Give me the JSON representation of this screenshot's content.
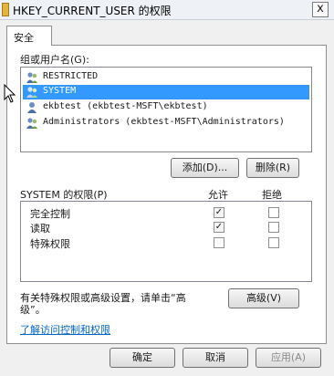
{
  "window": {
    "title": "HKEY_CURRENT_USER 的权限",
    "close_label": "x"
  },
  "tabs": [
    {
      "label": "安全"
    }
  ],
  "users_section": {
    "label": "组或用户名(G):",
    "items": [
      {
        "name": "RESTRICTED",
        "icon": "user-group-icon",
        "selected": false
      },
      {
        "name": "SYSTEM",
        "icon": "user-group-icon",
        "selected": true
      },
      {
        "name": "ekbtest (ekbtest-MSFT\\ekbtest)",
        "icon": "user-icon",
        "selected": false
      },
      {
        "name": "Administrators (ekbtest-MSFT\\Administrators)",
        "icon": "user-group-icon",
        "selected": false
      }
    ],
    "add_label": "添加(D)...",
    "remove_label": "删除(R)"
  },
  "permissions_section": {
    "label": "SYSTEM 的权限(P)",
    "allow_header": "允许",
    "deny_header": "拒绝",
    "rows": [
      {
        "name": "完全控制",
        "allow": true,
        "deny": false
      },
      {
        "name": "读取",
        "allow": true,
        "deny": false
      },
      {
        "name": "特殊权限",
        "allow": false,
        "deny": false
      }
    ]
  },
  "advanced": {
    "text_line1": "有关特殊权限或高级设置，请单击“高",
    "text_line2": "级”。",
    "button_label": "高级(V)"
  },
  "help_link": "了解访问控制和权限",
  "footer": {
    "ok_label": "确定",
    "cancel_label": "取消",
    "apply_label": "应用(A)"
  },
  "colors": {
    "selection": "#3399ff",
    "link": "#0066cc"
  }
}
